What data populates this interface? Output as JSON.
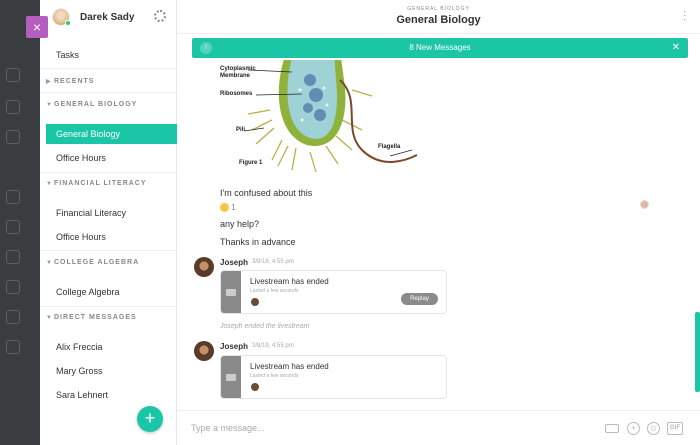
{
  "sidebar": {
    "user_name": "Darek Sady",
    "close_label": "×",
    "items": {
      "tasks": "Tasks",
      "recents": "RECENTS",
      "general_biology_section": "GENERAL BIOLOGY",
      "general_biology": "General Biology",
      "office_hours_1": "Office Hours",
      "financial_literacy_section": "FINANCIAL LITERACY",
      "financial_literacy": "Financial Literacy",
      "office_hours_2": "Office Hours",
      "college_algebra_section": "COLLEGE ALGEBRA",
      "college_algebra": "College Algebra",
      "direct_messages_section": "DIRECT MESSAGES",
      "dm_1": "Alix Freccia",
      "dm_2": "Mary Gross",
      "dm_3": "Sara Lehnert"
    },
    "fab_label": "+"
  },
  "header": {
    "kicker": "GENERAL BIOLOGY",
    "title": "General Biology"
  },
  "banner": {
    "text": "8 New Messages",
    "close": "✕",
    "up": "↑"
  },
  "figure": {
    "labels": {
      "cytoplasmic": "Cytoplasmic",
      "membrane": "Membrane",
      "ribosomes": "Ribosomes",
      "pili": "Pili",
      "flagella": "Flagella",
      "caption": "Figure 1"
    }
  },
  "messages": {
    "line1": "I'm confused about this",
    "reaction_count": "1",
    "line2": "any help?",
    "line3": "Thanks in advance",
    "post1": {
      "author": "Joseph",
      "time": "3/8/19, 4:55 pm",
      "card_title": "Livestream has ended",
      "card_sub": "Lasted a few seconds",
      "replay": "Replay"
    },
    "system": "Joseph ended the livestream",
    "post2": {
      "author": "Joseph",
      "time": "3/8/19, 4:55 pm",
      "card_title": "Livestream has ended",
      "card_sub": "Lasted a few seconds"
    }
  },
  "composer": {
    "placeholder": "Type a message...",
    "gif": "GIF"
  },
  "colors": {
    "accent": "#1bc6a6",
    "close_tab": "#b55ec0"
  }
}
